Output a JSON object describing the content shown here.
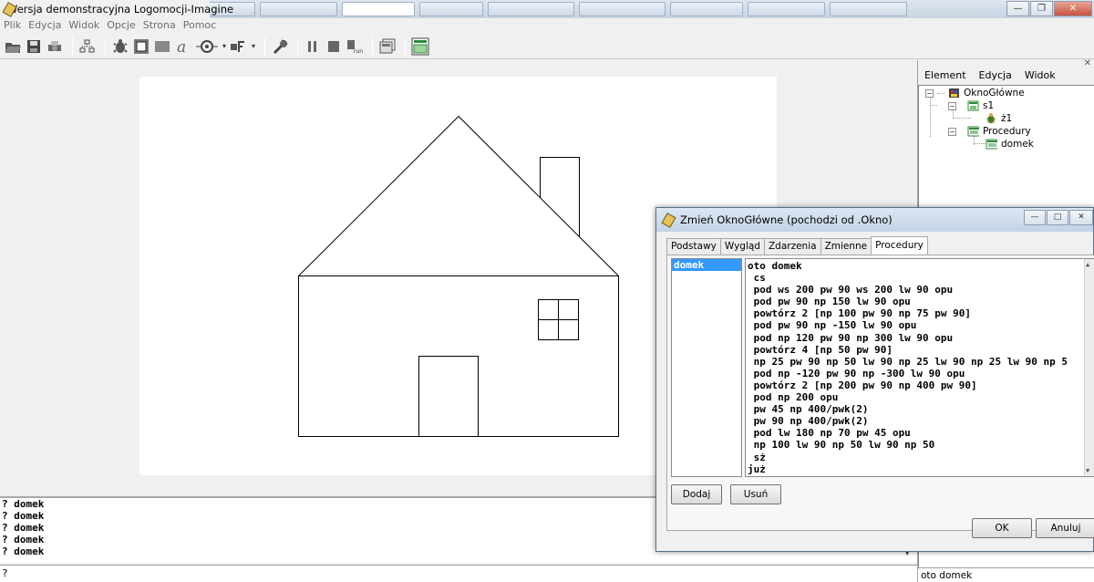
{
  "app": {
    "title": "Wersja demonstracyjna Logomocji-Imagine"
  },
  "menu": [
    "Plik",
    "Edycja",
    "Widok",
    "Opcje",
    "Strona",
    "Pomoc"
  ],
  "tree_panel": {
    "menu": [
      "Element",
      "Edycja",
      "Widok"
    ],
    "nodes": {
      "root": "OknoGłówne",
      "s1": "s1",
      "z1": "ż1",
      "procedures": "Procedury",
      "domek": "domek"
    },
    "status": "oto domek"
  },
  "console": {
    "lines": [
      "? domek",
      "? domek",
      "? domek",
      "? domek",
      "? domek"
    ],
    "prompt": "?"
  },
  "dialog": {
    "title": "Zmień OknoGłówne (pochodzi od .Okno)",
    "tabs": [
      "Podstawy",
      "Wygląd",
      "Zdarzenia",
      "Zmienne",
      "Procedury"
    ],
    "active_tab": "Procedury",
    "procedures": [
      "domek"
    ],
    "selected_procedure": "domek",
    "code": [
      "oto domek",
      " cs",
      " pod ws 200 pw 90 ws 200 lw 90 opu",
      " pod pw 90 np 150 lw 90 opu",
      " powtórz 2 [np 100 pw 90 np 75 pw 90]",
      " pod pw 90 np -150 lw 90 opu",
      " pod np 120 pw 90 np 300 lw 90 opu",
      " powtórz 4 [np 50 pw 90]",
      " np 25 pw 90 np 50 lw 90 np 25 lw 90 np 25 lw 90 np 5",
      " pod np -120 pw 90 np -300 lw 90 opu",
      " powtórz 2 [np 200 pw 90 np 400 pw 90]",
      " pod np 200 opu",
      " pw 45 np 400/pwk(2)",
      " pw 90 np 400/pwk(2)",
      " pod lw 180 np 70 pw 45 opu",
      " np 100 lw 90 np 50 lw 90 np 50",
      " sż",
      "już"
    ],
    "buttons": {
      "add": "Dodaj",
      "remove": "Usuń",
      "ok": "OK",
      "cancel": "Anuluj"
    }
  },
  "colors": {
    "selection": "#3399ff",
    "line": "#000000"
  }
}
